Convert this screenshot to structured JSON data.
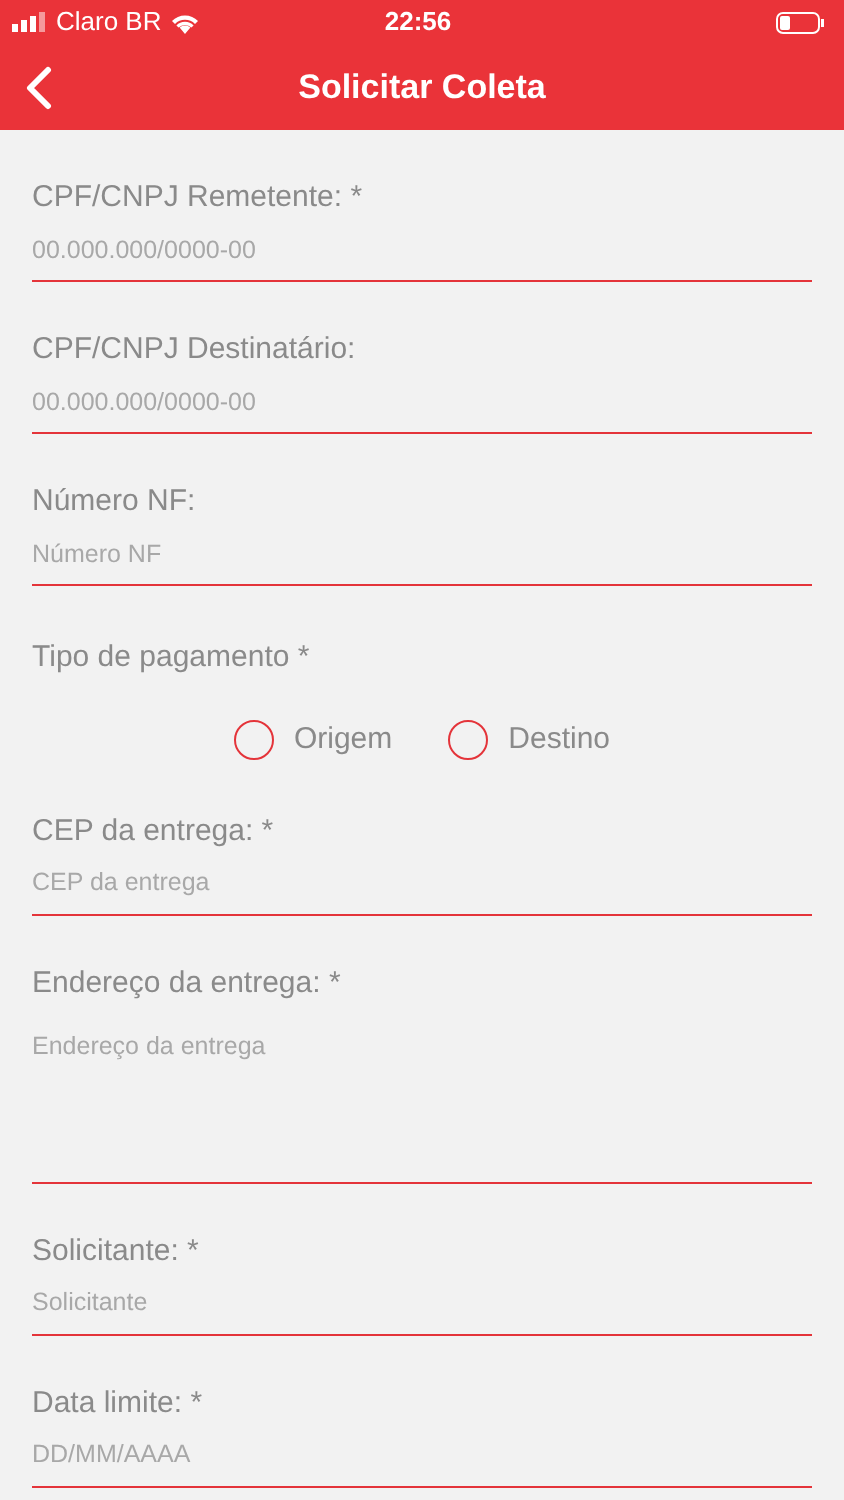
{
  "status_bar": {
    "carrier": "Claro BR",
    "time": "22:56"
  },
  "header": {
    "title": "Solicitar Coleta"
  },
  "fields": [
    {
      "kind": "input",
      "label": "CPF/CNPJ Remetente: *",
      "placeholder": "00.000.000/0000-00"
    },
    {
      "kind": "input",
      "label": "CPF/CNPJ Destinatário:",
      "placeholder": "00.000.000/0000-00"
    },
    {
      "kind": "input",
      "label": "Número NF:",
      "placeholder": "Número NF"
    },
    {
      "kind": "radio",
      "label": "Tipo de pagamento *",
      "options": [
        {
          "label": "Origem",
          "selected": false
        },
        {
          "label": "Destino",
          "selected": false
        }
      ]
    },
    {
      "kind": "input",
      "label": "CEP da entrega: *",
      "placeholder": "CEP da entrega"
    },
    {
      "kind": "textarea",
      "label": "Endereço da entrega: *",
      "placeholder": "Endereço da entrega"
    },
    {
      "kind": "input",
      "label": "Solicitante: *",
      "placeholder": "Solicitante"
    },
    {
      "kind": "input",
      "label": "Data limite: *",
      "placeholder": "DD/MM/AAAA"
    }
  ]
}
